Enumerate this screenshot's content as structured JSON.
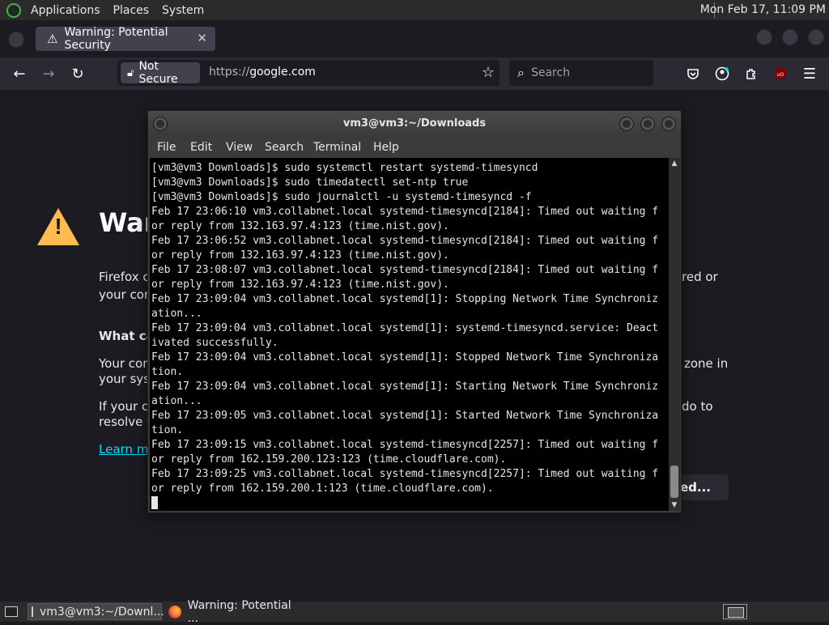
{
  "top_panel": {
    "menus": [
      "Applications",
      "Places",
      "System"
    ],
    "clock": "Mon Feb 17, 11:09 PM"
  },
  "firefox": {
    "tab": {
      "title": "Warning: Potential Security",
      "close": "✕",
      "icon": "warning-icon"
    },
    "nav": {
      "back": "←",
      "forward": "→",
      "reload": "↻"
    },
    "urlbar": {
      "security_label": "Not Secure",
      "url_scheme": "https://",
      "url_host": "google.com"
    },
    "search": {
      "placeholder": "Search"
    },
    "toolbar_icons": [
      "pocket-icon",
      "account-icon",
      "extensions-icon",
      "ublock-icon",
      "menu-icon"
    ]
  },
  "warning_page": {
    "title_fragment": "War",
    "line1_left": "Firefox c",
    "line1_right": "red or",
    "line2_left": "your cor",
    "subhead": "What car",
    "para1_left": "Your com",
    "para1_right": "zone in",
    "para1_left2": "your syst",
    "para2_left": "If your clo",
    "para2_right": "do to",
    "para2_left2": "resolve th",
    "learn_more": "Learn mo",
    "advanced_button": "ced..."
  },
  "terminal": {
    "title": "vm3@vm3:~/Downloads",
    "menu": [
      "File",
      "Edit",
      "View",
      "Search",
      "Terminal",
      "Help"
    ],
    "lines": [
      "[vm3@vm3 Downloads]$ sudo systemctl restart systemd-timesyncd",
      "[vm3@vm3 Downloads]$ sudo timedatectl set-ntp true",
      "[vm3@vm3 Downloads]$ sudo journalctl -u systemd-timesyncd -f",
      "Feb 17 23:06:10 vm3.collabnet.local systemd-timesyncd[2184]: Timed out waiting f",
      "or reply from 132.163.97.4:123 (time.nist.gov).",
      "Feb 17 23:06:52 vm3.collabnet.local systemd-timesyncd[2184]: Timed out waiting f",
      "or reply from 132.163.97.4:123 (time.nist.gov).",
      "Feb 17 23:08:07 vm3.collabnet.local systemd-timesyncd[2184]: Timed out waiting f",
      "or reply from 132.163.97.4:123 (time.nist.gov).",
      "Feb 17 23:09:04 vm3.collabnet.local systemd[1]: Stopping Network Time Synchroniz",
      "ation...",
      "Feb 17 23:09:04 vm3.collabnet.local systemd[1]: systemd-timesyncd.service: Deact",
      "ivated successfully.",
      "Feb 17 23:09:04 vm3.collabnet.local systemd[1]: Stopped Network Time Synchroniza",
      "tion.",
      "Feb 17 23:09:04 vm3.collabnet.local systemd[1]: Starting Network Time Synchroniz",
      "ation...",
      "Feb 17 23:09:05 vm3.collabnet.local systemd[1]: Started Network Time Synchroniza",
      "tion.",
      "Feb 17 23:09:15 vm3.collabnet.local systemd-timesyncd[2257]: Timed out waiting f",
      "or reply from 162.159.200.123:123 (time.cloudflare.com).",
      "Feb 17 23:09:25 vm3.collabnet.local systemd-timesyncd[2257]: Timed out waiting f",
      "or reply from 162.159.200.1:123 (time.cloudflare.com)."
    ]
  },
  "taskbar": {
    "items": [
      "vm3@vm3:~/Downl...",
      "Warning: Potential ..."
    ]
  }
}
